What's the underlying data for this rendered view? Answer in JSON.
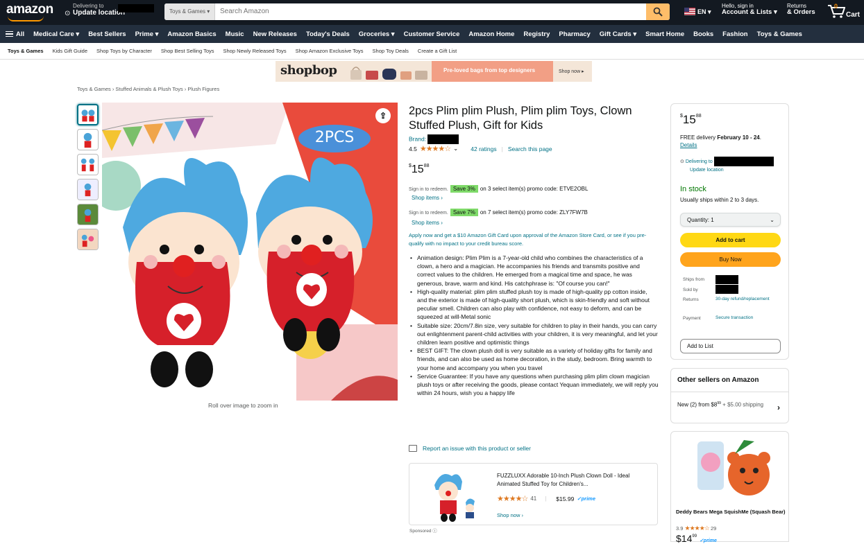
{
  "header": {
    "logo": "amazon",
    "deliver_line1": "Delivering to",
    "deliver_line2": "Update location",
    "search_category": "Toys & Games",
    "search_placeholder": "Search Amazon",
    "language": "EN",
    "account_line1": "Hello, sign in",
    "account_line2": "Account & Lists",
    "returns_line1": "Returns",
    "returns_line2": "& Orders",
    "cart_count": "0",
    "cart_label": "Cart"
  },
  "nav": {
    "all": "All",
    "items": [
      "Medical Care",
      "Best Sellers",
      "Prime",
      "Amazon Basics",
      "Music",
      "New Releases",
      "Today's Deals",
      "Groceries",
      "Customer Service",
      "Amazon Home",
      "Registry",
      "Pharmacy",
      "Gift Cards",
      "Smart Home",
      "Books",
      "Fashion",
      "Toys & Games"
    ]
  },
  "subnav": {
    "items": [
      "Toys & Games",
      "Kids Gift Guide",
      "Shop Toys by Character",
      "Shop Best Selling Toys",
      "Shop Newly Released Toys",
      "Shop Amazon Exclusive Toys",
      "Shop Toy Deals",
      "Create a Gift List"
    ]
  },
  "banner": {
    "brand": "shopbop",
    "tagline": "Pre-loved bags from top designers",
    "cta": "Shop now"
  },
  "breadcrumb": "Toys & Games › Stuffed Animals & Plush Toys › Plush Figures",
  "gallery": {
    "overlay_text": "2PCS",
    "zoom_hint": "Roll over image to zoom in"
  },
  "product": {
    "title": "2pcs Plim plim Plush, Plim plim Toys, Clown Stuffed Plush, Gift for Kids",
    "brand_label": "Brand:",
    "rating_value": "4.5",
    "stars": "★★★★☆",
    "ratings_count": "42 ratings",
    "search_page": "Search this page",
    "price_symbol": "$",
    "price_whole": "15",
    "price_fraction": "88",
    "promo1": {
      "prefix": "Sign in to redeem.",
      "save": "Save 3%",
      "text": "on 3 select item(s) promo code: ETVE2OBL",
      "link": "Shop items ›"
    },
    "promo2": {
      "prefix": "Sign in to redeem.",
      "save": "Save 7%",
      "text": "on 7 select item(s) promo code: ZLY7FW7B",
      "link": "Shop items ›"
    },
    "gift_card": "Apply now and get a $10 Amazon Gift Card upon approval of the Amazon Store Card, or see if you pre-qualify with no impact to your credit bureau score.",
    "bullets": [
      "Animation design: Plim Plim is a 7-year-old child who combines the characteristics of a clown, a hero and a magician. He accompanies his friends and transmits positive and correct values to the children. He emerged from a magical time and space, he was generous, brave, warm and kind. His catchphrase is: \"Of course you can!\"",
      "High-quality material: plim plim stuffed plush toy is made of high-quality pp cotton inside, and the exterior is made of high-quality short plush, which is skin-friendly and soft without peculiar smell. Children can also play with confidence, not easy to deform, and can be squeezed at will-Metal sonic",
      "Suitable size: 20cm/7.8in size, very suitable for children to play in their hands, you can carry out enlightenment parent-child activities with your children, it is very meaningful, and let your children learn positive and optimistic things",
      "BEST GIFT: The clown plush doll is very suitable as a variety of holiday gifts for family and friends, and can also be used as home decoration, in the study, bedroom. Bring warmth to your home and accompany you when you travel",
      "Service Guarantee: If you have any questions when purchasing plim plim clown magician plush toys or after receiving the goods, please contact Yequan immediately, we will reply you within 24 hours, wish you a happy life"
    ],
    "report": "Report an issue with this product or seller"
  },
  "sponsored": {
    "title": "FUZZLUXX Adorable 10-Inch Plush Clown Doll - Ideal Animated Stuffed Toy for Children's...",
    "stars": "★★★★☆",
    "count": "41",
    "price": "$15.99",
    "prime": "✓prime",
    "cta": "Shop now ›",
    "label": "Sponsored ⓘ"
  },
  "buybox": {
    "price_symbol": "$",
    "price_whole": "15",
    "price_fraction": "88",
    "delivery_prefix": "FREE delivery",
    "delivery_date": "February 10 - 24",
    "details": "Details",
    "loc_line1": "Delivering to",
    "loc_line2": "Update location",
    "stock": "In stock",
    "ships": "Usually ships within 2 to 3 days.",
    "quantity": "Quantity: 1",
    "add_to_cart": "Add to cart",
    "buy_now": "Buy Now",
    "ships_from_label": "Ships from",
    "sold_by_label": "Sold by",
    "returns_label": "Returns",
    "returns_value": "30-day refund/replacement",
    "payment_label": "Payment",
    "payment_value": "Secure transaction",
    "add_to_list": "Add to List"
  },
  "other_sellers": {
    "heading": "Other sellers on Amazon",
    "line_prefix": "New (2) from",
    "price_whole": "$8",
    "price_fraction": "99",
    "shipping": "+ $5.00 shipping"
  },
  "ad": {
    "title": "Deddy Bears Mega SquishMe (Squash Bear)",
    "rating": "3.9",
    "stars": "★★★★☆",
    "count": "29",
    "price_whole": "$14",
    "price_fraction": "99",
    "prime": "✓prime"
  },
  "colors": {
    "top_bar": "#131921",
    "nav_bar": "#232f3e",
    "accent": "#febd69",
    "link": "#007185",
    "in_stock": "#007600",
    "add_to_cart": "#ffd814",
    "buy_now": "#ffa41c"
  }
}
